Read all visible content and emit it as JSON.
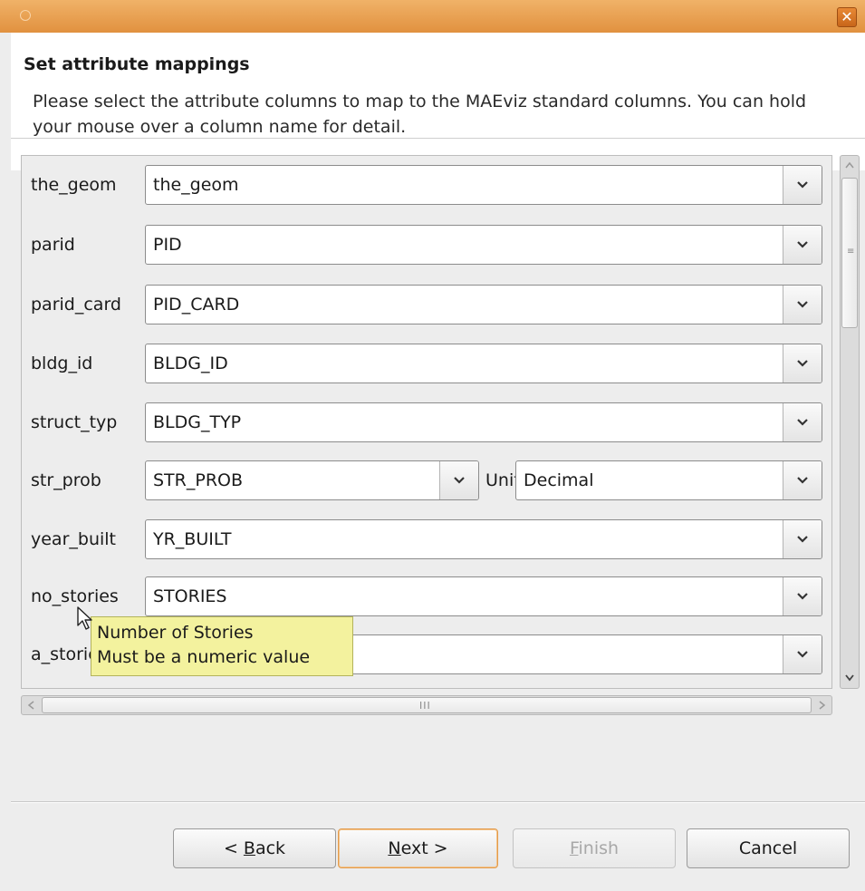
{
  "window": {
    "close_glyph": "✕"
  },
  "header": {
    "title": "Set attribute mappings",
    "description": "Please select the attribute columns to map to the MAEviz standard columns.  You can hold your mouse over a column name for detail."
  },
  "rows": [
    {
      "label": "the_geom",
      "value": "the_geom"
    },
    {
      "label": "parid",
      "value": "PID"
    },
    {
      "label": "parid_card",
      "value": "PID_CARD"
    },
    {
      "label": "bldg_id",
      "value": "BLDG_ID"
    },
    {
      "label": "struct_typ",
      "value": "BLDG_TYP"
    },
    {
      "label": "str_prob",
      "value": "STR_PROB",
      "unit_label": "Unit",
      "unit_value": "Decimal"
    },
    {
      "label": "year_built",
      "value": "YR_BUILT"
    },
    {
      "label": "no_stories",
      "value": "STORIES"
    },
    {
      "label": "a_stories",
      "value": ""
    }
  ],
  "tooltip": {
    "line1": "Number of Stories",
    "line2": " Must be a numeric value"
  },
  "buttons": {
    "back": {
      "prefix": "< ",
      "mnemonic": "B",
      "rest": "ack"
    },
    "next": {
      "mnemonic": "N",
      "rest": "ext >"
    },
    "finish": {
      "mnemonic": "F",
      "rest": "inish"
    },
    "cancel": {
      "label": "Cancel"
    }
  }
}
